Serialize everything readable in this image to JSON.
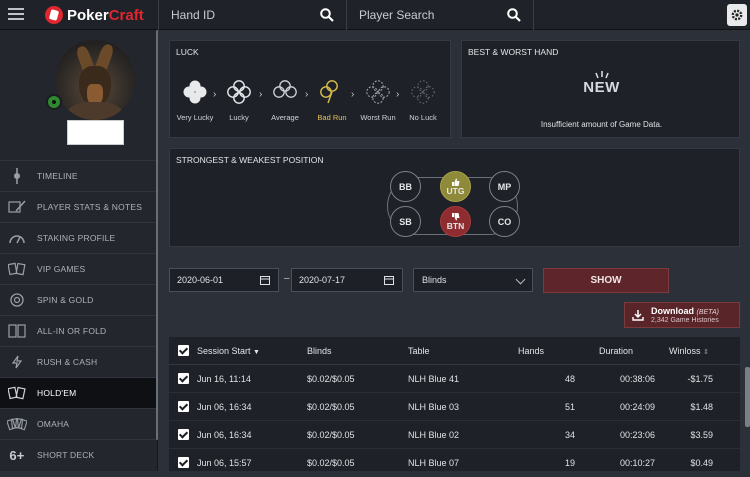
{
  "app": {
    "logo_part1": "Poker",
    "logo_part2": "Craft"
  },
  "topbar": {
    "hand_search_placeholder": "Hand ID",
    "player_search_placeholder": "Player Search"
  },
  "sidebar": {
    "items": [
      {
        "label": "TIMELINE",
        "icon": "timeline-icon"
      },
      {
        "label": "PLAYER STATS & NOTES",
        "icon": "notes-icon"
      },
      {
        "label": "STAKING PROFILE",
        "icon": "gauge-icon"
      },
      {
        "label": "VIP GAMES",
        "icon": "cards-icon"
      },
      {
        "label": "SPIN & GOLD",
        "icon": "chip-icon"
      },
      {
        "label": "ALL-IN OR FOLD",
        "icon": "allin-icon"
      },
      {
        "label": "RUSH & CASH",
        "icon": "rush-icon"
      },
      {
        "label": "HOLD'EM",
        "icon": "holdem-icon",
        "active": true
      },
      {
        "label": "OMAHA",
        "icon": "omaha-icon"
      },
      {
        "label": "SHORT DECK",
        "icon": "shortdeck-icon",
        "glyph": "6+"
      }
    ]
  },
  "luck": {
    "title": "LUCK",
    "levels": [
      "Very Lucky",
      "Lucky",
      "Average",
      "Bad Run",
      "Worst Run",
      "No Luck"
    ],
    "highlighted": "Bad Run"
  },
  "best_worst": {
    "title": "BEST & WORST HAND",
    "new_label": "NEW",
    "message": "Insufficient amount of Game Data."
  },
  "positions": {
    "title": "STRONGEST & WEAKEST POSITION",
    "labels": {
      "bb": "BB",
      "utg": "UTG",
      "mp": "MP",
      "sb": "SB",
      "btn": "BTN",
      "co": "CO"
    },
    "strongest": "UTG",
    "weakest": "BTN"
  },
  "filters": {
    "date_from": "2020-06-01",
    "separator": "–",
    "date_to": "2020-07-17",
    "blinds_label": "Blinds",
    "show_label": "SHOW"
  },
  "download": {
    "label": "Download",
    "beta": "(BETA)",
    "sub": "2,342 Game Histories"
  },
  "table": {
    "headers": {
      "session_start": "Session Start",
      "blinds": "Blinds",
      "table": "Table",
      "hands": "Hands",
      "duration": "Duration",
      "winloss": "Winloss"
    },
    "rows": [
      {
        "session_start": "Jun 16, 11:14",
        "blinds": "$0.02/$0.05",
        "table": "NLH Blue 41",
        "hands": "48",
        "duration": "00:38:06",
        "winloss": "-$1.75"
      },
      {
        "session_start": "Jun 06, 16:34",
        "blinds": "$0.02/$0.05",
        "table": "NLH Blue 03",
        "hands": "51",
        "duration": "00:24:09",
        "winloss": "$1.48"
      },
      {
        "session_start": "Jun 06, 16:34",
        "blinds": "$0.02/$0.05",
        "table": "NLH Blue 02",
        "hands": "34",
        "duration": "00:23:06",
        "winloss": "$3.59"
      },
      {
        "session_start": "Jun 06, 15:57",
        "blinds": "$0.02/$0.05",
        "table": "NLH Blue 07",
        "hands": "19",
        "duration": "00:10:27",
        "winloss": "$0.49"
      }
    ]
  },
  "colors": {
    "accent_red": "#e0262e",
    "good_position": "#8f8a3a",
    "bad_position": "#8e2c2f",
    "highlight_text": "#e6c25a"
  }
}
